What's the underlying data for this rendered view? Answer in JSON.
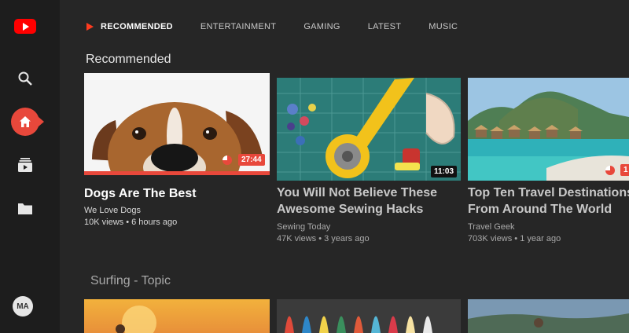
{
  "sidebar": {
    "logo_icon": "youtube-play-icon",
    "items": [
      {
        "icon": "search-icon"
      },
      {
        "icon": "home-icon"
      },
      {
        "icon": "subscriptions-icon"
      },
      {
        "icon": "folder-icon"
      }
    ],
    "avatar_initials": "MA"
  },
  "tabs": [
    {
      "label": "RECOMMENDED",
      "active": true
    },
    {
      "label": "ENTERTAINMENT"
    },
    {
      "label": "GAMING"
    },
    {
      "label": "LATEST"
    },
    {
      "label": "MUSIC"
    }
  ],
  "sections": {
    "recommended": {
      "title": "Recommended"
    },
    "surfing": {
      "title": "Surfing - Topic"
    }
  },
  "videos": [
    {
      "title": "Dogs Are The Best",
      "channel": "We Love Dogs",
      "stats": "10K views • 6 hours ago",
      "duration": "27:44",
      "focused": true
    },
    {
      "title_line1": "You Will Not Believe These",
      "title_line2": "Awesome Sewing Hacks",
      "channel": "Sewing Today",
      "stats": "47K views • 3 years ago",
      "duration": "11:03"
    },
    {
      "title_line1": "Top Ten Travel Destinations",
      "title_line2": "From Around The World",
      "channel": "Travel Geek",
      "stats": "703K views • 1 year ago",
      "duration": "1"
    }
  ],
  "colors": {
    "accent": "#e8483b",
    "brand": "#ff0000",
    "background": "#262626"
  }
}
